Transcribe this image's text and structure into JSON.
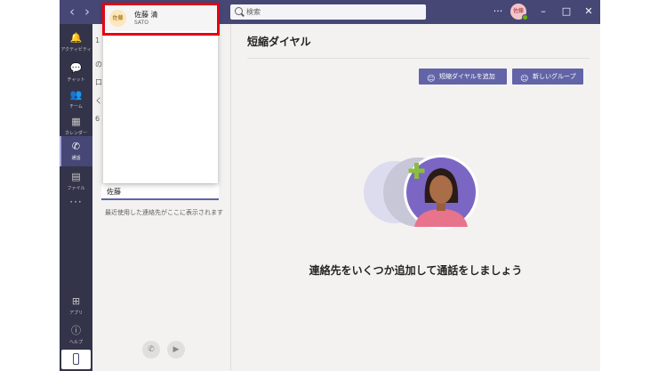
{
  "titlebar": {
    "search_placeholder": "検索",
    "more_label": "···",
    "avatar_initials": "佐藤"
  },
  "appbar": {
    "items": [
      {
        "label": "アクティビティ",
        "icon": "bell-icon"
      },
      {
        "label": "チャット",
        "icon": "chat-icon"
      },
      {
        "label": "チーム",
        "icon": "teams-icon"
      },
      {
        "label": "カレンダー",
        "icon": "calendar-icon"
      },
      {
        "label": "通話",
        "icon": "phone-icon"
      },
      {
        "label": "ファイル",
        "icon": "file-icon"
      }
    ],
    "more_label": "···",
    "apps_label": "アプリ",
    "help_label": "ヘルプ"
  },
  "list_pane": {
    "input_value": "佐藤",
    "recent_hint": "最近使用した連絡先がここに表示されます",
    "peek": [
      "1",
      "の",
      "口",
      "く",
      "6"
    ]
  },
  "dropdown": {
    "result": {
      "initials": "佐藤",
      "name": "佐藤 清",
      "subtitle": "SATO"
    }
  },
  "main": {
    "title": "短縮ダイヤル",
    "add_speed_dial_label": "短縮ダイヤルを追加",
    "new_group_label": "新しいグループ",
    "empty_message": "連絡先をいくつか追加して通話をしましょう"
  },
  "colors": {
    "titlebar": "#464775",
    "appbar": "#33344a",
    "accent": "#6264a7",
    "highlight_border": "#e60012"
  }
}
